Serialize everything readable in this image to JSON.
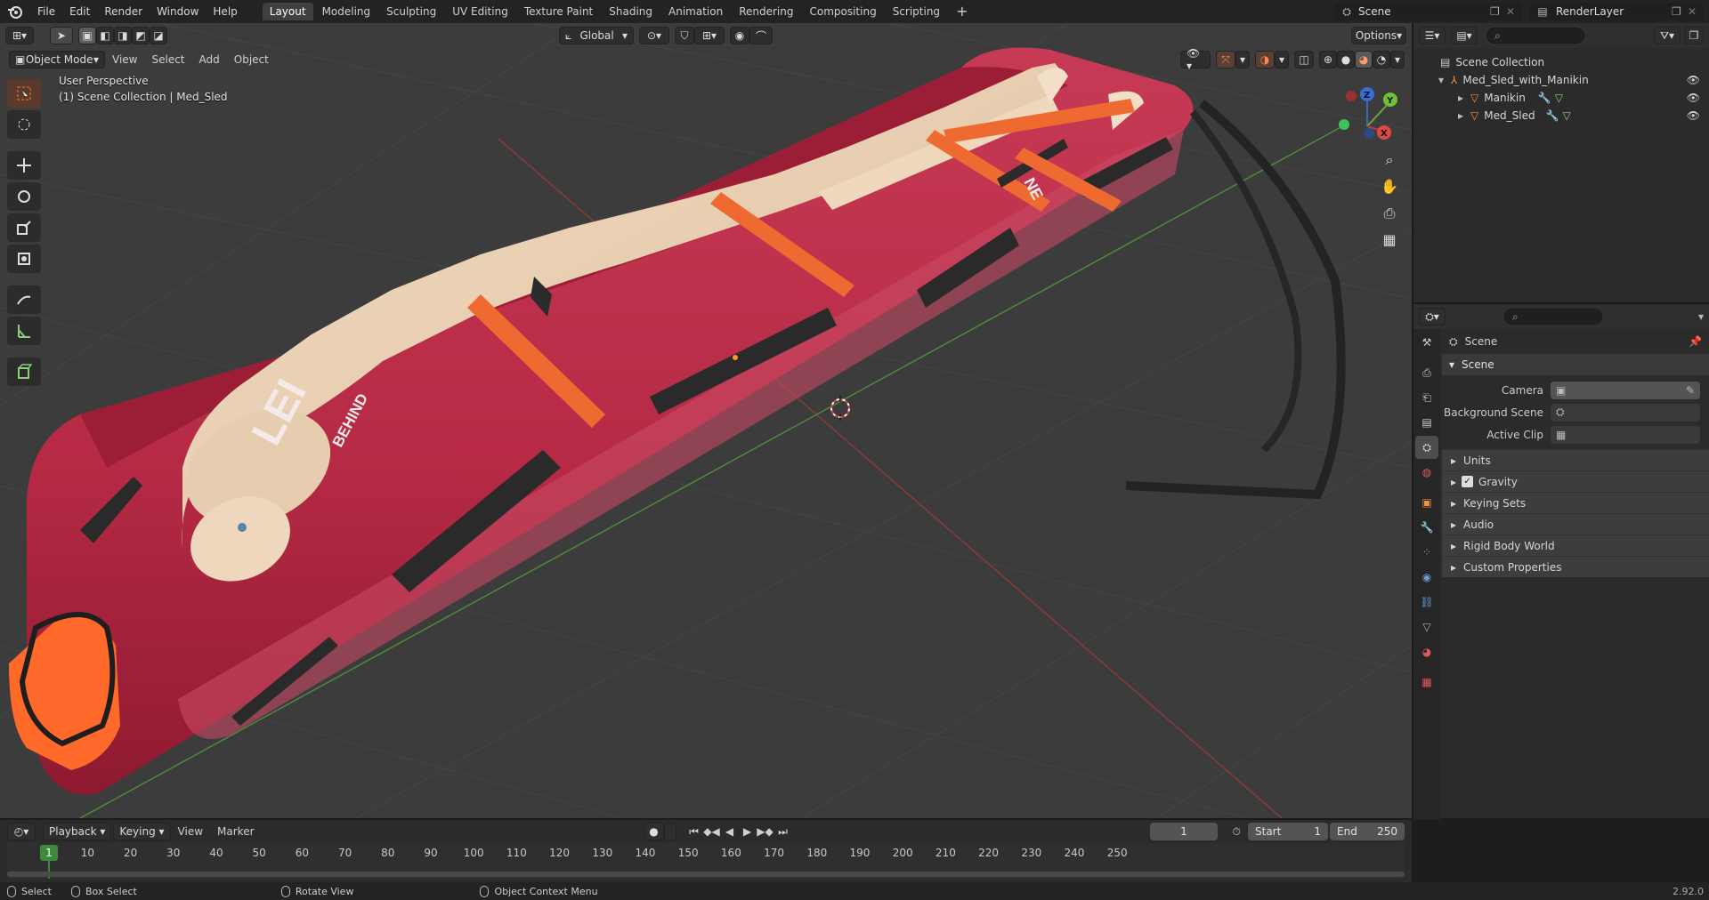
{
  "topbar": {
    "menus": [
      "File",
      "Edit",
      "Render",
      "Window",
      "Help"
    ],
    "workspaces": [
      "Layout",
      "Modeling",
      "Sculpting",
      "UV Editing",
      "Texture Paint",
      "Shading",
      "Animation",
      "Rendering",
      "Compositing",
      "Scripting"
    ],
    "active_workspace": "Layout",
    "scene_name": "Scene",
    "view_layer": "RenderLayer"
  },
  "viewport": {
    "mode": "Object Mode",
    "menus": [
      "View",
      "Select",
      "Add",
      "Object"
    ],
    "orientation": "Global",
    "options_label": "Options",
    "info_line1": "User Perspective",
    "info_line2": "(1) Scene Collection | Med_Sled",
    "sled_text_large": "LEI",
    "sled_text_small": "BEHIND",
    "sled_text_foot": "NE",
    "gizmo": {
      "z": "Z",
      "y": "Y",
      "x": "X"
    }
  },
  "outliner": {
    "root": "Scene Collection",
    "items": [
      {
        "name": "Med_Sled_with_Manikin",
        "depth": 1
      },
      {
        "name": "Manikin",
        "depth": 2
      },
      {
        "name": "Med_Sled",
        "depth": 2
      }
    ]
  },
  "properties": {
    "context_title": "Scene",
    "panel_title": "Scene",
    "fields": [
      {
        "label": "Camera",
        "value": ""
      },
      {
        "label": "Background Scene",
        "value": ""
      },
      {
        "label": "Active Clip",
        "value": ""
      }
    ],
    "subpanels": [
      "Units",
      "Gravity",
      "Keying Sets",
      "Audio",
      "Rigid Body World",
      "Custom Properties"
    ],
    "gravity_checked": true
  },
  "timeline": {
    "menus": [
      "Playback",
      "Keying",
      "View",
      "Marker"
    ],
    "current_frame": "1",
    "start_label": "Start",
    "start_value": "1",
    "end_label": "End",
    "end_value": "250",
    "ticks": [
      "1",
      "10",
      "20",
      "30",
      "40",
      "50",
      "60",
      "70",
      "80",
      "90",
      "100",
      "110",
      "120",
      "130",
      "140",
      "150",
      "160",
      "170",
      "180",
      "190",
      "200",
      "210",
      "220",
      "230",
      "240",
      "250"
    ]
  },
  "statusbar": {
    "select": "Select",
    "box_select": "Box Select",
    "rotate_view": "Rotate View",
    "context_menu": "Object Context Menu",
    "version": "2.92.0"
  },
  "colors": {
    "accent": "#e07a3a",
    "active_tab": "#404040",
    "sled_red": "#b8253e",
    "strap_orange": "#ef6a30"
  }
}
